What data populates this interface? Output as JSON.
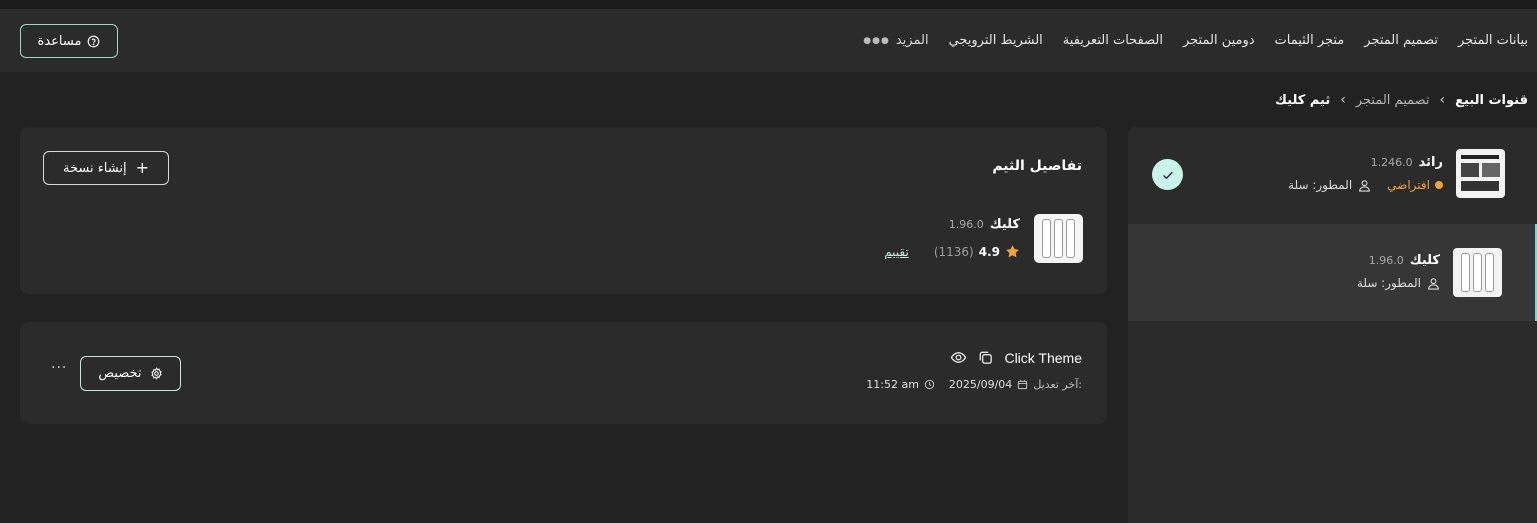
{
  "nav": {
    "items": [
      "بيانات المتجر",
      "تصميم المتجر",
      "متجر الثيمات",
      "دومين المتجر",
      "الصفحات التعريفية",
      "الشريط الترويجي"
    ],
    "more_label": "المزيد",
    "help_label": "مساعدة"
  },
  "breadcrumb": {
    "root": "قنوات البيع",
    "middle": "تصميم المتجر",
    "current": "ثيم كليك"
  },
  "sidebar": {
    "themes": [
      {
        "name": "رائد",
        "version": "1.246.0",
        "default_label": "افتراضي",
        "developer": "المطور: سلة",
        "active": true
      },
      {
        "name": "كليك",
        "version": "1.96.0",
        "developer": "المطور: سلة",
        "selected": true
      }
    ]
  },
  "details": {
    "title": "تفاصيل الثيم",
    "create_copy": "إنشاء نسخة",
    "theme_name": "كليك",
    "theme_version": "1.96.0",
    "rating": "4.9",
    "rating_count": "(1136)",
    "rate_link": "تقييم"
  },
  "version_card": {
    "name": "Click Theme",
    "last_modified_label": "آخر تعديل:",
    "date": "2025/09/04",
    "time": "11:52 am",
    "customize": "تخصيص",
    "more": "···"
  },
  "colors": {
    "accent": "#9ed8cb",
    "default_badge": "#f0a232",
    "star": "#f0a232",
    "check_bg": "#c9f4ea"
  }
}
